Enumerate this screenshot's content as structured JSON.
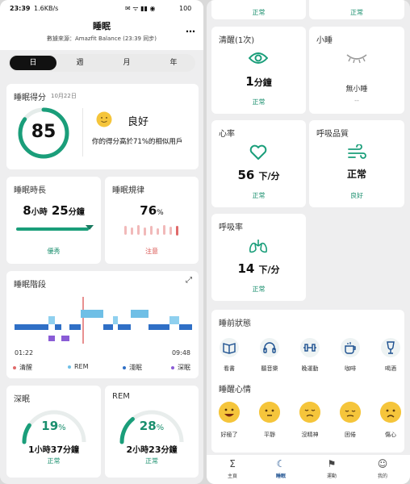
{
  "status": {
    "time": "23:39",
    "speed": "1.6KB/s",
    "battery": "100"
  },
  "header": {
    "title": "睡眠",
    "source": "數據來源：Amazfit Balance (23:39 同步)"
  },
  "segments": [
    "日",
    "週",
    "月",
    "年"
  ],
  "score": {
    "title": "睡眠得分",
    "date": "10月22日",
    "value": "85",
    "value_fraction": 0.85,
    "rating": "良好",
    "desc": "你的得分高於71%的相似用戶"
  },
  "duration": {
    "title": "睡眠時長",
    "hours": "8",
    "hours_unit": "小時",
    "minutes": "25",
    "minutes_unit": "分鐘",
    "status": "優秀"
  },
  "regularity": {
    "title": "睡眠規律",
    "value": "76",
    "unit": "%",
    "status": "注意"
  },
  "stages": {
    "title": "睡眠階段",
    "start": "01:22",
    "end": "09:48",
    "legend": [
      {
        "label": "清醒",
        "color": "#e06a6a"
      },
      {
        "label": "REM",
        "color": "#6fbfe6"
      },
      {
        "label": "淺眠",
        "color": "#2f6fc6"
      },
      {
        "label": "深眠",
        "color": "#8a5cd6"
      }
    ]
  },
  "deep": {
    "title": "深眠",
    "percent": "19",
    "percent_fraction": 0.19,
    "hours": "1",
    "hours_unit": "小時",
    "minutes": "37",
    "minutes_unit": "分鐘",
    "status": "正常"
  },
  "rem": {
    "title": "REM",
    "percent": "28",
    "percent_fraction": 0.28,
    "hours": "2",
    "hours_unit": "小時",
    "minutes": "23",
    "minutes_unit": "分鐘",
    "status": "正常"
  },
  "right_top": {
    "left_status": "正常",
    "right_status": "正常"
  },
  "awake": {
    "title": "清醒(1次)",
    "value": "1",
    "unit": "分鐘",
    "status": "正常"
  },
  "nap": {
    "title": "小睡",
    "value": "無小睡",
    "sub": "--"
  },
  "heart": {
    "title": "心率",
    "value": "56",
    "unit": "下/分",
    "status": "正常"
  },
  "breath_quality": {
    "title": "呼吸品質",
    "value": "正常",
    "status": "良好"
  },
  "breath_rate": {
    "title": "呼吸率",
    "value": "14",
    "unit": "下/分",
    "status": "正常"
  },
  "pre_sleep": {
    "title": "睡前狀態",
    "items": [
      "看書",
      "聽音樂",
      "晚運動",
      "咖啡",
      "喝酒"
    ]
  },
  "mood": {
    "title": "睡醒心情",
    "items": [
      "好極了",
      "平靜",
      "沒精神",
      "困倦",
      "傷心"
    ]
  },
  "tabs": [
    "主頁",
    "睡眠",
    "運動",
    "我的"
  ]
}
